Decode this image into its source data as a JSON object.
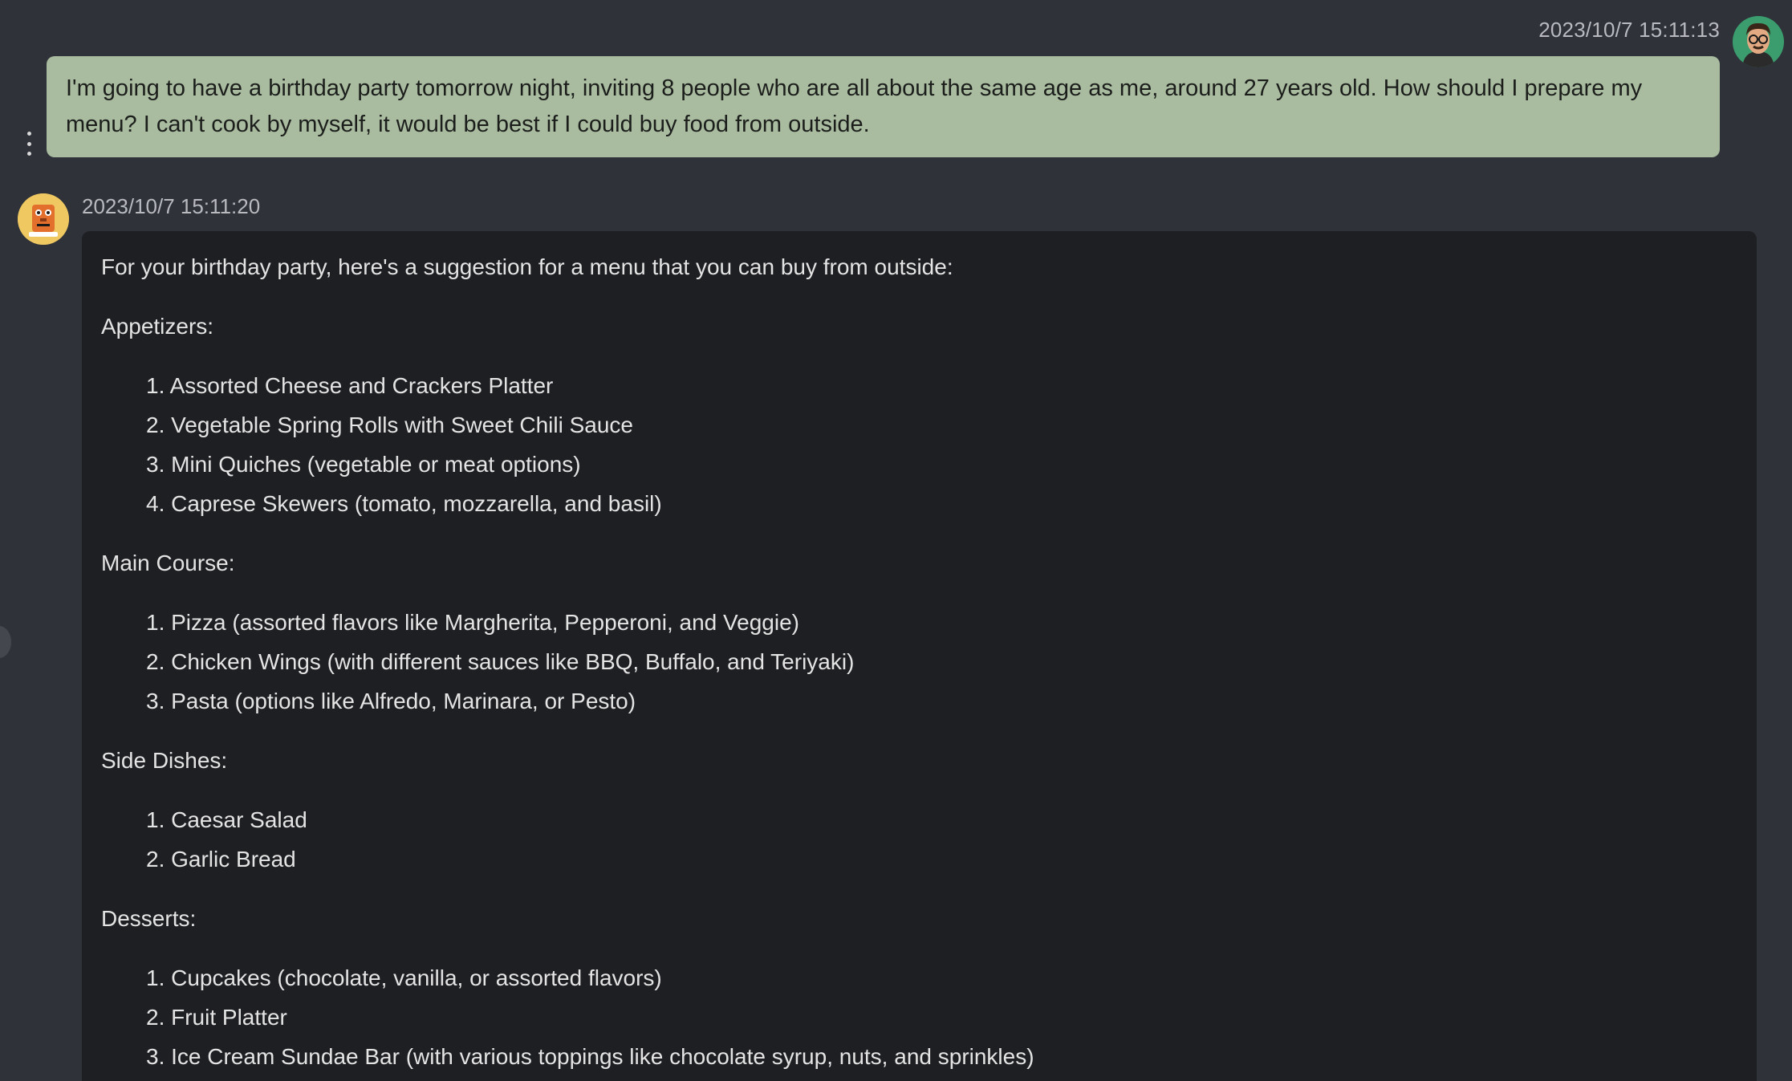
{
  "user_message": {
    "timestamp": "2023/10/7 15:11:13",
    "text": "I'm going to have a birthday party tomorrow night, inviting 8 people who are all about the same age as me, around 27 years old. How should I prepare my menu? I can't cook by myself, it would be best if I could buy food from outside.",
    "avatar_icon": "user-avatar-icon",
    "bubble_color": "#a9bca0"
  },
  "bot_message": {
    "timestamp": "2023/10/7 15:11:20",
    "avatar_icon": "robot-avatar-icon",
    "intro": "For your birthday party, here's a suggestion for a menu that you can buy from outside:",
    "sections": [
      {
        "heading": "Appetizers:",
        "items": [
          "1. Assorted Cheese and Crackers Platter",
          "2. Vegetable Spring Rolls with Sweet Chili Sauce",
          "3. Mini Quiches (vegetable or meat options)",
          "4. Caprese Skewers (tomato, mozzarella, and basil)"
        ]
      },
      {
        "heading": "Main Course:",
        "items": [
          "1. Pizza (assorted flavors like Margherita, Pepperoni, and Veggie)",
          "2. Chicken Wings (with different sauces like BBQ, Buffalo, and Teriyaki)",
          "3. Pasta (options like Alfredo, Marinara, or Pesto)"
        ]
      },
      {
        "heading": "Side Dishes:",
        "items": [
          "1. Caesar Salad",
          "2. Garlic Bread"
        ]
      },
      {
        "heading": "Desserts:",
        "items": [
          "1. Cupcakes (chocolate, vanilla, or assorted flavors)",
          "2. Fruit Platter",
          "3. Ice Cream Sundae Bar (with various toppings like chocolate syrup, nuts, and sprinkles)"
        ]
      }
    ]
  },
  "message_menu_icon": "more-vertical-icon",
  "colors": {
    "background": "#30323a",
    "bot_bubble": "#1e1f23"
  }
}
